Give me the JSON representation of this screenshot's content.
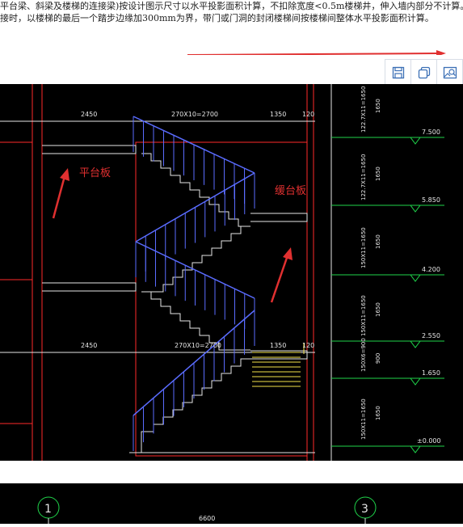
{
  "note": {
    "line1": "平台梁、斜梁及楼梯的连接梁)按设计图示尺寸以水平投影面积计算，不扣除宽度<0.5m楼梯井，伸入墙内部分不计算。当",
    "line2": "接时，以楼梯的最后一个踏步边缘加300mm为界，带门或门洞的封闭楼梯间按楼梯间整体水平投影面积计算。"
  },
  "toolbar": {
    "save_icon": "save-icon",
    "copy_icon": "copy-icon",
    "image_icon": "image-icon"
  },
  "drawing": {
    "dim_top": [
      "2450",
      "270X10=2700",
      "1350",
      "120"
    ],
    "dim_mid": [
      "2450",
      "270X10=2700",
      "1350",
      "120"
    ],
    "label_platform": "平台板",
    "label_landing": "缓台板",
    "elevations": [
      "7.500",
      "5.850",
      "4.200",
      "2.550",
      "1.650",
      "±0.000"
    ],
    "vertical_dims": [
      "122.7X11=1650",
      "1650",
      "122.7X11=1650",
      "1650",
      "150X11=1650",
      "1650",
      "150X11=1650",
      "1650",
      "150X6=900",
      "900",
      "150X11=1650",
      "1650"
    ]
  },
  "plan": {
    "axis_1": "1",
    "axis_3": "3",
    "dim": "6600"
  },
  "colors": {
    "cad_bg": "#000000",
    "stair": "#5a6cff",
    "wall": "#ff2a2a",
    "dim": "#e6e6e6",
    "green": "#1fd34a",
    "yellow": "#f2e24a",
    "arrow": "#e03030"
  }
}
